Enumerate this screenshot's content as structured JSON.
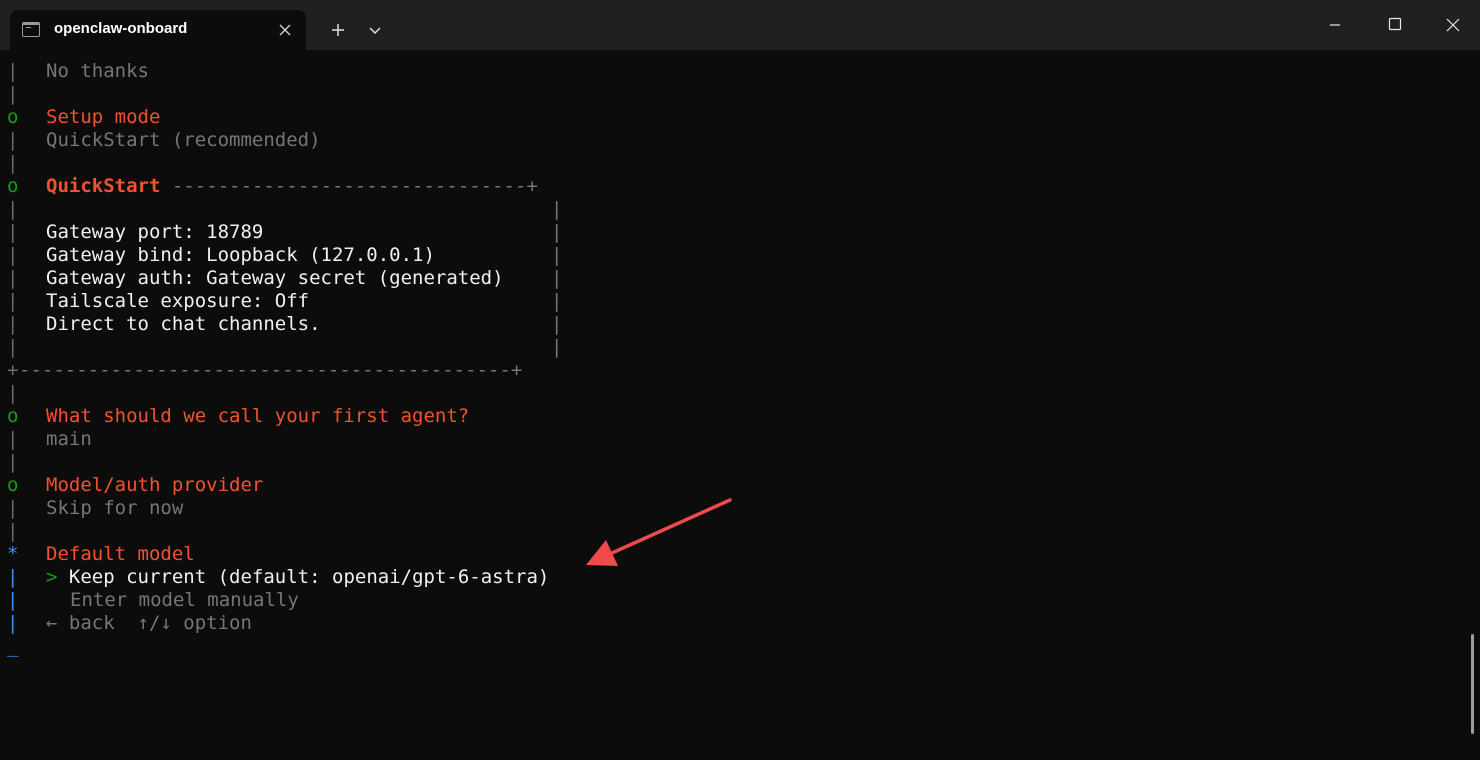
{
  "window": {
    "tab_title": "openclaw-onboard"
  },
  "colors": {
    "background": "#0c0c0c",
    "titlebar": "#202020",
    "heading_orange": "#f2522d",
    "done_marker_green": "#13a10e",
    "active_marker_blue": "#3b8eea",
    "dim_text": "#767676",
    "annotation_arrow": "#f04a4a"
  },
  "icons": {
    "tab": "terminal-icon",
    "tab_close": "close-icon",
    "new_tab": "plus-icon",
    "dropdown": "chevron-down-icon",
    "minimize": "minimize-icon",
    "maximize": "maximize-icon",
    "close": "close-icon",
    "annotation": "arrow-icon"
  },
  "terminal": {
    "markers": {
      "bar": "|",
      "done": "o",
      "active": "*",
      "cursor": "_",
      "corner": "+"
    },
    "prev_answer": "No thanks",
    "setup_mode": {
      "heading": "Setup mode",
      "value": "QuickStart (recommended)"
    },
    "quickstart": {
      "heading": "QuickStart",
      "top_rule": " -------------------------------+",
      "bottom_rule": "-------------------------------------------+",
      "lines": [
        "Gateway port: 18789",
        "Gateway bind: Loopback (127.0.0.1)",
        "Gateway auth: Gateway secret (generated)",
        "Tailscale exposure: Off",
        "Direct to chat channels."
      ]
    },
    "agent_name": {
      "heading": "What should we call your first agent?",
      "value": "main"
    },
    "provider": {
      "heading": "Model/auth provider",
      "value": "Skip for now"
    },
    "default_model": {
      "heading": "Default model",
      "pointer": ">",
      "options": [
        "Keep current (default: openai/gpt-6-astra)",
        "Enter model manually"
      ],
      "hint": "← back  ↑/↓ option"
    }
  }
}
